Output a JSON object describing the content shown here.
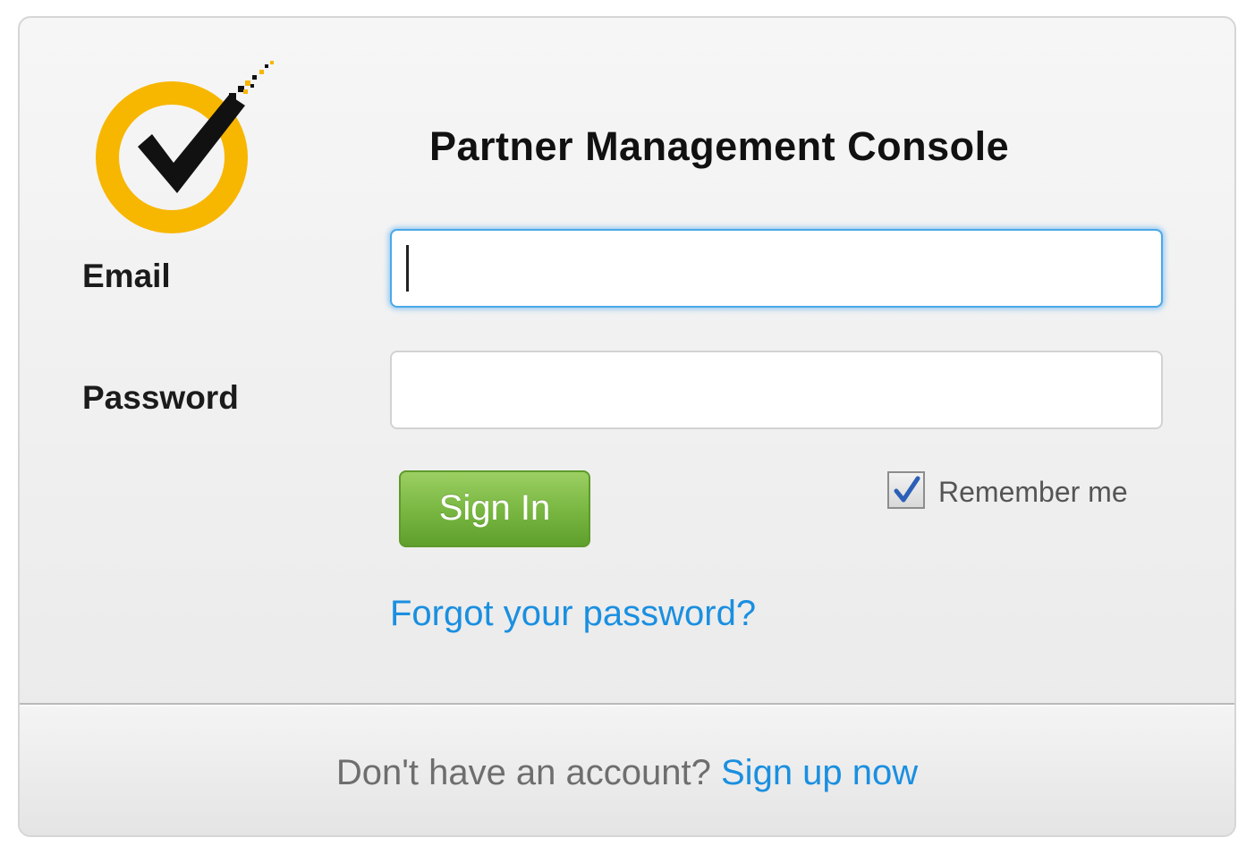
{
  "header": {
    "title": "Partner Management Console",
    "logo": "checkmark-logo"
  },
  "form": {
    "email_label": "Email",
    "email_value": "",
    "password_label": "Password",
    "password_value": "",
    "signin_label": "Sign In",
    "remember_label": "Remember me",
    "remember_checked": true,
    "forgot_link": "Forgot your password?"
  },
  "footer": {
    "prompt": "Don't have an account?",
    "signup_link": "Sign up now"
  },
  "colors": {
    "logo_ring": "#f7b600",
    "button_green": "#7ab843",
    "link_blue": "#1a8fe0",
    "focus_blue": "#4aa8e8"
  }
}
